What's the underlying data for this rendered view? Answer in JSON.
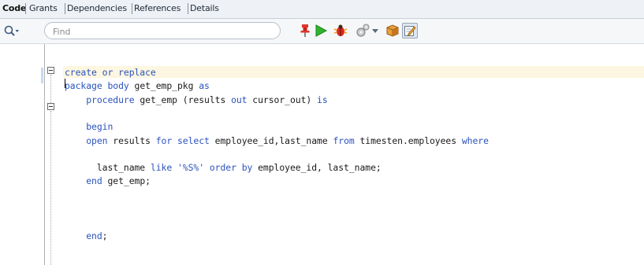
{
  "tabs": [
    {
      "label": "Code",
      "active": true
    },
    {
      "label": "Grants",
      "active": false
    },
    {
      "label": "Dependencies",
      "active": false
    },
    {
      "label": "References",
      "active": false
    },
    {
      "label": "Details",
      "active": false
    }
  ],
  "toolbar": {
    "search_placeholder": "Find",
    "icons": [
      "search-dropdown-icon",
      "pin-icon",
      "run-icon",
      "debug-icon",
      "settings-icon",
      "dropdown-arrow-icon",
      "compile-icon",
      "edit-icon"
    ]
  },
  "colors": {
    "keyword": "#2a52be",
    "text": "#1a1a1a",
    "current_line": "#fdf6e0",
    "tab_bar": "#eef1f5"
  },
  "code": {
    "lines": [
      {
        "segments": [
          {
            "t": "create or replace",
            "k": true
          }
        ]
      },
      {
        "segments": [
          {
            "t": "package",
            "k": true
          },
          {
            "t": " "
          },
          {
            "t": "body",
            "k": true
          },
          {
            "t": " get_emp_pkg "
          },
          {
            "t": "as",
            "k": true
          }
        ]
      },
      {
        "segments": [
          {
            "t": "    "
          },
          {
            "t": "procedure",
            "k": true
          },
          {
            "t": " get_emp (results "
          },
          {
            "t": "out",
            "k": true
          },
          {
            "t": " cursor_out) "
          },
          {
            "t": "is",
            "k": true
          }
        ]
      },
      {
        "segments": []
      },
      {
        "segments": [
          {
            "t": "    "
          },
          {
            "t": "begin",
            "k": true
          }
        ]
      },
      {
        "segments": [
          {
            "t": "    "
          },
          {
            "t": "open",
            "k": true
          },
          {
            "t": " results "
          },
          {
            "t": "for",
            "k": true
          },
          {
            "t": " "
          },
          {
            "t": "select",
            "k": true
          },
          {
            "t": " employee_id,last_name "
          },
          {
            "t": "from",
            "k": true
          },
          {
            "t": " timesten.employees "
          },
          {
            "t": "where",
            "k": true
          }
        ]
      },
      {
        "segments": []
      },
      {
        "segments": [
          {
            "t": "      last_name "
          },
          {
            "t": "like",
            "k": true
          },
          {
            "t": " "
          },
          {
            "t": "'%S%'",
            "k": true
          },
          {
            "t": " "
          },
          {
            "t": "order by",
            "k": true
          },
          {
            "t": " employee_id, last_name;"
          }
        ]
      },
      {
        "segments": [
          {
            "t": "    "
          },
          {
            "t": "end",
            "k": true
          },
          {
            "t": " get_emp;"
          }
        ]
      },
      {
        "segments": []
      },
      {
        "segments": []
      },
      {
        "segments": []
      },
      {
        "segments": [
          {
            "t": "    "
          },
          {
            "t": "end",
            "k": true
          },
          {
            "t": ";"
          }
        ]
      }
    ]
  }
}
